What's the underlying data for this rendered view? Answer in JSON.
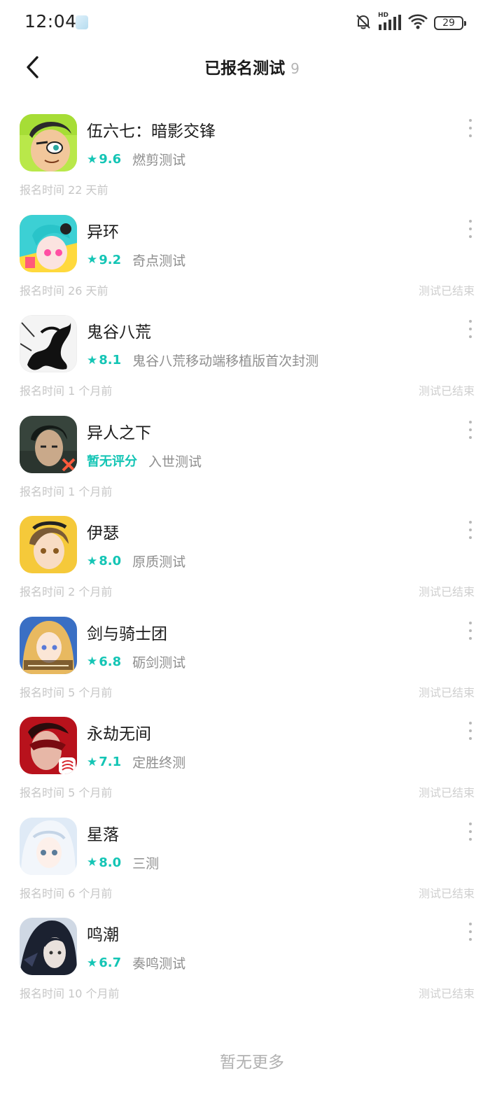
{
  "status_bar": {
    "time": "12:04",
    "battery": "29",
    "hd_label": "HD"
  },
  "header": {
    "title": "已报名测试",
    "count": "9"
  },
  "items": [
    {
      "name": "伍六七：暗影交锋",
      "rating": "9.6",
      "test": "燃剪测试",
      "signup": "报名时间 22 天前",
      "status": "",
      "icon": "wuliuqi-icon"
    },
    {
      "name": "异环",
      "rating": "9.2",
      "test": "奇点测试",
      "signup": "报名时间 26 天前",
      "status": "测试已结束",
      "icon": "yihuan-icon"
    },
    {
      "name": "鬼谷八荒",
      "rating": "8.1",
      "test": "鬼谷八荒移动端移植版首次封测",
      "signup": "报名时间 1 个月前",
      "status": "测试已结束",
      "icon": "guigubahuang-icon"
    },
    {
      "name": "异人之下",
      "rating": "暂无评分",
      "test": "入世测试",
      "signup": "报名时间 1 个月前",
      "status": "",
      "icon": "yirenzhixia-icon"
    },
    {
      "name": "伊瑟",
      "rating": "8.0",
      "test": "原质测试",
      "signup": "报名时间 2 个月前",
      "status": "测试已结束",
      "icon": "yise-icon"
    },
    {
      "name": "剑与骑士团",
      "rating": "6.8",
      "test": "砺剑测试",
      "signup": "报名时间 5 个月前",
      "status": "测试已结束",
      "icon": "jianyuqishituan-icon"
    },
    {
      "name": "永劫无间",
      "rating": "7.1",
      "test": "定胜终测",
      "signup": "报名时间 5 个月前",
      "status": "测试已结束",
      "icon": "yongjiewujian-icon"
    },
    {
      "name": "星落",
      "rating": "8.0",
      "test": "三测",
      "signup": "报名时间 6 个月前",
      "status": "测试已结束",
      "icon": "xingluo-icon"
    },
    {
      "name": "鸣潮",
      "rating": "6.7",
      "test": "奏鸣测试",
      "signup": "报名时间 10 个月前",
      "status": "测试已结束",
      "icon": "mingchao-icon"
    }
  ],
  "footer": {
    "text": "暂无更多"
  },
  "colors": {
    "accent": "#14c5b5",
    "muted": "#8e8e8e",
    "faint": "#c6c6c6"
  }
}
